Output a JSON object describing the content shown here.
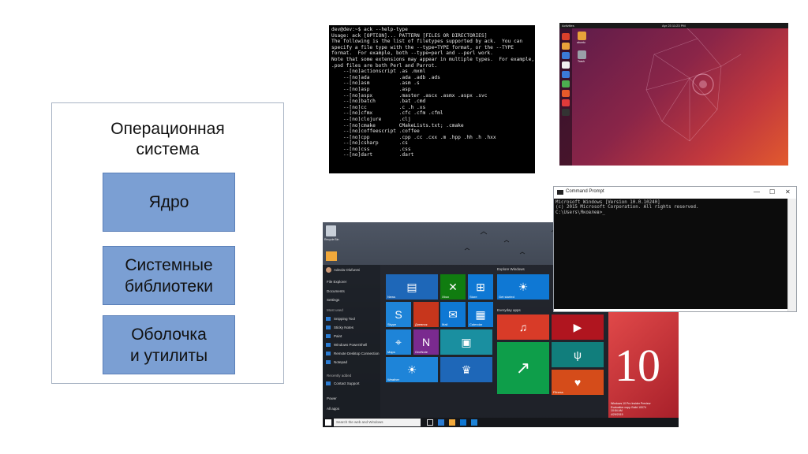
{
  "diagram": {
    "title": "Операционная\nсистема",
    "kernel": "Ядро",
    "libraries": "Системные\nбиблиотеки",
    "shell": "Оболочка\nи утилиты"
  },
  "terminal": {
    "lines": [
      "dev@dev:~$ ack --help-type",
      "Usage: ack [OPTION]... PATTERN [FILES OR DIRECTORIES]",
      "",
      "The following is the list of filetypes supported by ack.  You can",
      "specify a file type with the --type=TYPE format, or the --TYPE",
      "format.  For example, both --type=perl and --perl work.",
      "",
      "Note that some extensions may appear in multiple types.  For example,",
      ".pod files are both Perl and Parrot.",
      "",
      "    --[no]actionscript .as .mxml",
      "    --[no]ada          .ada .adb .ads",
      "    --[no]asm          .asm .s",
      "    --[no]asp          .asp",
      "    --[no]aspx         .master .ascx .asmx .aspx .svc",
      "    --[no]batch        .bat .cmd",
      "    --[no]cc           .c .h .xs",
      "    --[no]cfmx         .cfc .cfm .cfml",
      "    --[no]clojure      .clj",
      "    --[no]cmake        CMakeLists.txt; .cmake",
      "    --[no]coffeescript .coffee",
      "    --[no]cpp          .cpp .cc .cxx .m .hpp .hh .h .hxx",
      "    --[no]csharp       .cs",
      "    --[no]css          .css",
      "    --[no]dart         .dart"
    ]
  },
  "ubuntu": {
    "activities": "Activities",
    "clock": "Apr 23  11:23 PM",
    "desktop_icons": [
      "ubuntu",
      "Trash"
    ],
    "dock_colors": [
      "#d9402b",
      "#e8a33a",
      "#3b7ad8",
      "#f0f0f0",
      "#3b7ad8",
      "#4caf50",
      "#e85a2a",
      "#e03a3a",
      "#333333"
    ]
  },
  "windows": {
    "recycle_bin": "Recycle Bin",
    "user": "Adeola Olufunmi",
    "left_items": [
      "File Explorer",
      "Documents",
      "Settings"
    ],
    "most_used_header": "Most used",
    "most_used": [
      "Snipping Tool",
      "Sticky Notes",
      "Paint",
      "Windows PowerShell",
      "Remote Desktop Connection",
      "Notepad"
    ],
    "recently_added_header": "Recently added",
    "recently_added": [
      "Contact Support"
    ],
    "power": "Power",
    "all_apps": "All apps",
    "explore_header": "Explore Windows",
    "everyday_header": "Everyday apps",
    "tiles": {
      "news": "News",
      "xbox": "Xbox",
      "store": "Store",
      "get_started": "Get started",
      "skype": "Skype",
      "onenote2": "Дневник",
      "mail": "Mail",
      "calendar": "Calendar",
      "maps": "Maps",
      "onenote": "OneNote",
      "weather": "Weather",
      "fitness": "Fitness"
    },
    "search_placeholder": "Search the web and Windows",
    "ten": "10",
    "watermark": "Windows 10 Pro Insider Preview\nEvaluation copy. Build 10074\n10:54 AM\n4/29/2015"
  },
  "cmd": {
    "title": "Command Prompt",
    "lines": [
      "Microsoft Windows [Version 10.0.10240]",
      "(c) 2015 Microsoft Corporation. All rights reserved.",
      "",
      "C:\\Users\\Яковлев>_"
    ],
    "controls": [
      "—",
      "☐",
      "✕"
    ]
  }
}
